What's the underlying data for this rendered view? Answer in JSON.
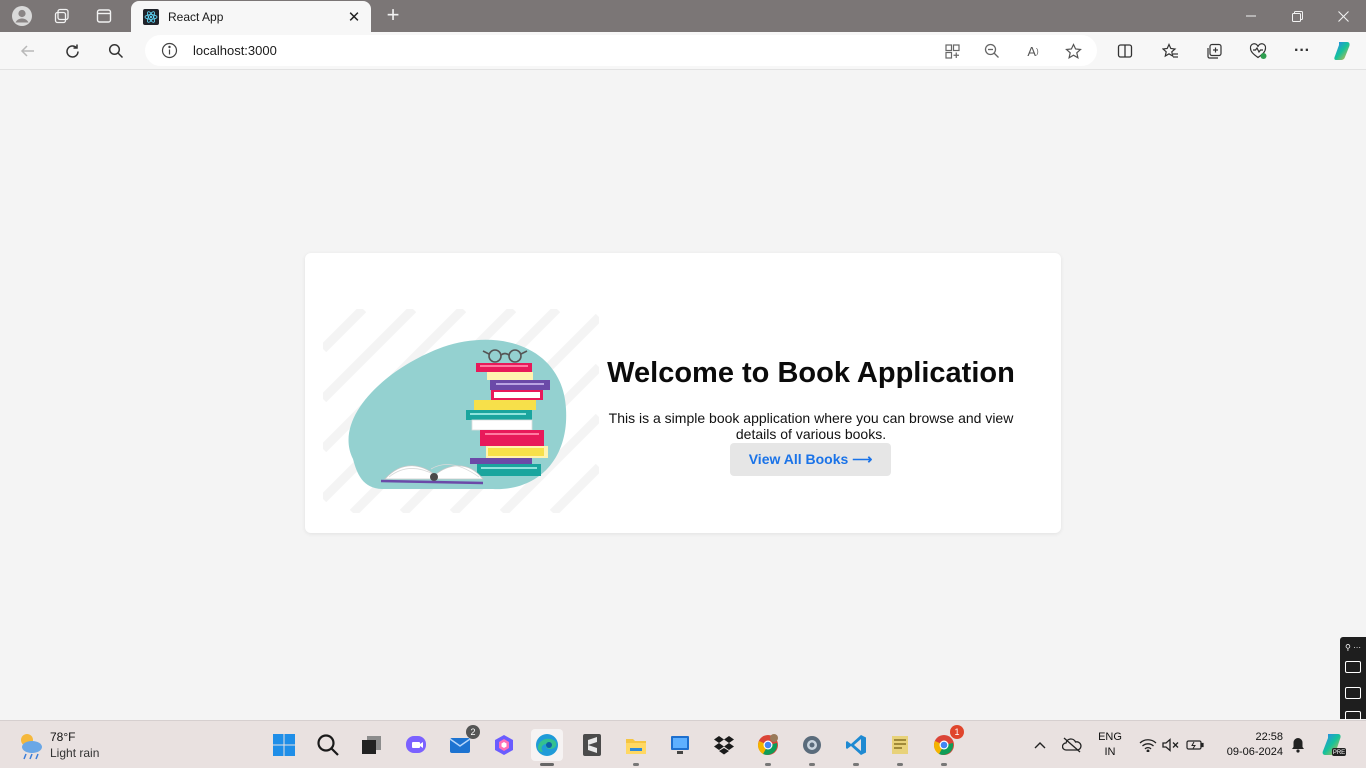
{
  "browser": {
    "tab_title": "React App",
    "url": "localhost:3000"
  },
  "page": {
    "heading": "Welcome to Book Application",
    "description": "This is a simple book application where you can browse and view details of various books.",
    "view_button_label": "View All Books ⟶"
  },
  "taskbar": {
    "weather": {
      "temp": "78°F",
      "condition": "Light rain"
    },
    "mail_badge": "2",
    "chrome_badge": "1",
    "language_line1": "ENG",
    "language_line2": "IN",
    "time": "22:58",
    "date": "09-06-2024"
  },
  "colors": {
    "accent_link": "#1a73e8",
    "titlebar": "#7b7676",
    "page_bg": "#f4f4f4"
  }
}
